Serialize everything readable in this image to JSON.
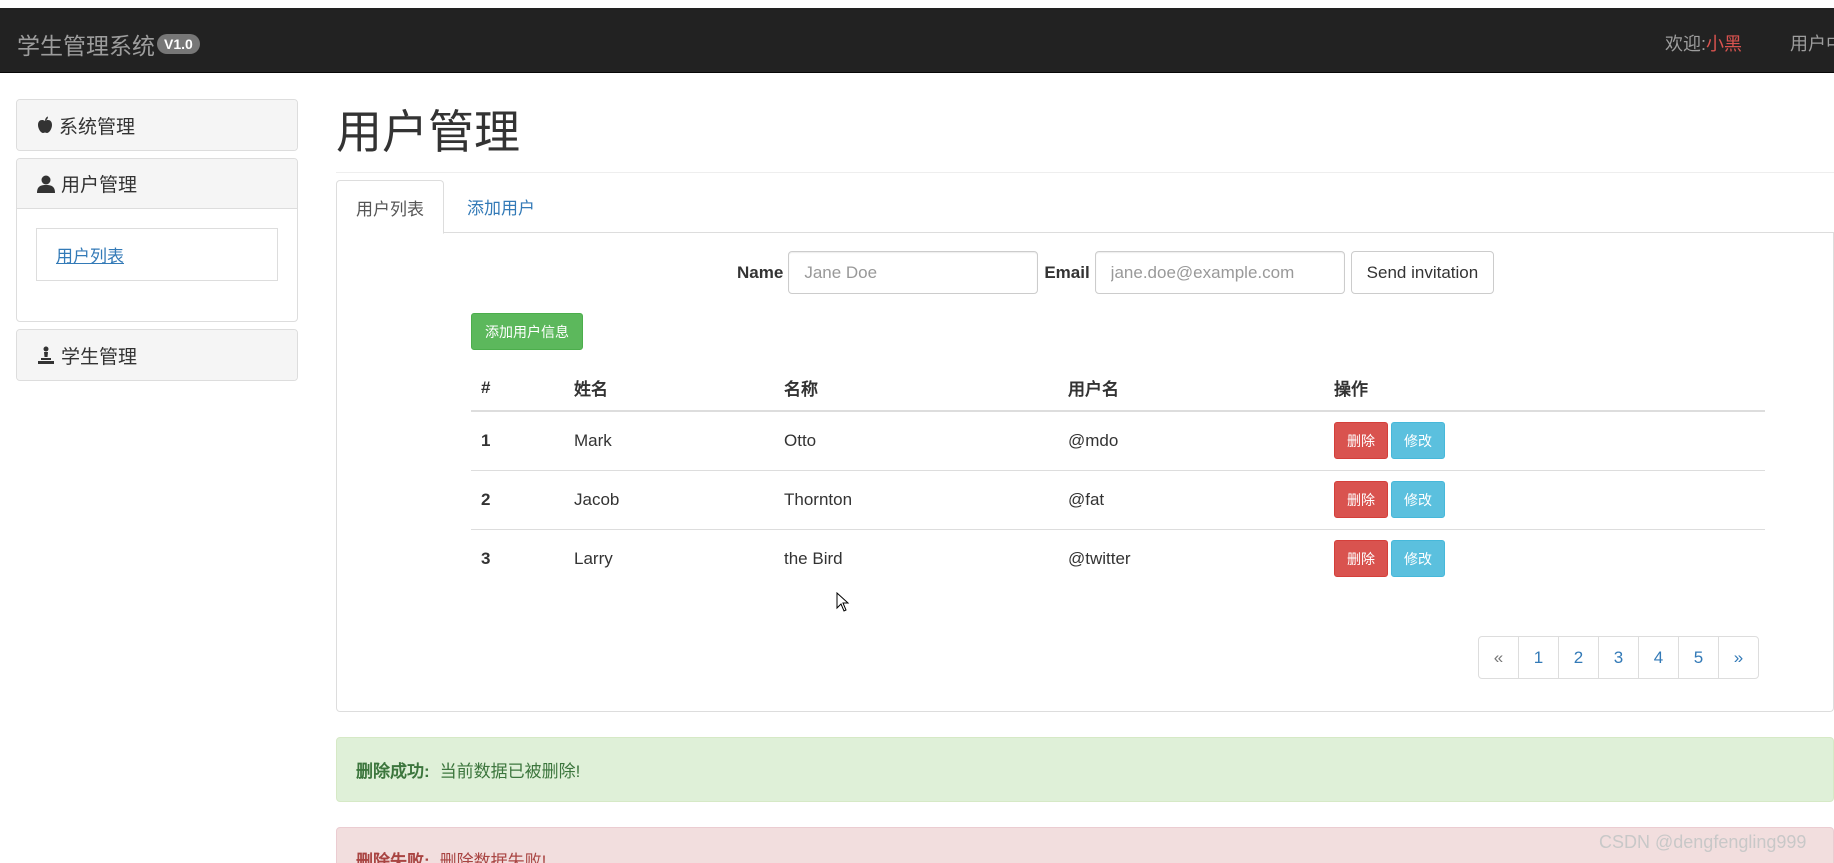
{
  "navbar": {
    "brand": "学生管理系统",
    "version": "V1.0",
    "welcome_label": "欢迎:",
    "username": "小黑",
    "user_center": "用户中心"
  },
  "sidebar": {
    "items": [
      {
        "label": "系统管理",
        "icon": "apple-icon"
      },
      {
        "label": "用户管理",
        "icon": "user-icon",
        "children": [
          "用户列表"
        ]
      },
      {
        "label": "学生管理",
        "icon": "pawn-icon"
      }
    ]
  },
  "main": {
    "title": "用户管理",
    "tabs": [
      "用户列表",
      "添加用户"
    ],
    "form": {
      "name_label": "Name",
      "name_placeholder": "Jane Doe",
      "email_label": "Email",
      "email_placeholder": "jane.doe@example.com",
      "submit_label": "Send invitation"
    },
    "add_button": "添加用户信息",
    "table": {
      "headers": [
        "#",
        "姓名",
        "名称",
        "用户名",
        "操作"
      ],
      "rows": [
        {
          "id": "1",
          "first": "Mark",
          "last": "Otto",
          "username": "@mdo"
        },
        {
          "id": "2",
          "first": "Jacob",
          "last": "Thornton",
          "username": "@fat"
        },
        {
          "id": "3",
          "first": "Larry",
          "last": "the Bird",
          "username": "@twitter"
        }
      ],
      "delete_label": "删除",
      "edit_label": "修改"
    },
    "pagination": [
      "«",
      "1",
      "2",
      "3",
      "4",
      "5",
      "»"
    ]
  },
  "alerts": {
    "success": {
      "title": "删除成功:",
      "message": "当前数据已被删除!"
    },
    "danger": {
      "title": "删除失败:",
      "message": "删除数据失败!"
    }
  },
  "watermark": "CSDN @dengfengling999",
  "colors": {
    "navbar_bg": "#222222",
    "username": "#d9534f",
    "success": "#5cb85c",
    "danger": "#d9534f",
    "info": "#5bc0de",
    "link": "#337ab7"
  }
}
